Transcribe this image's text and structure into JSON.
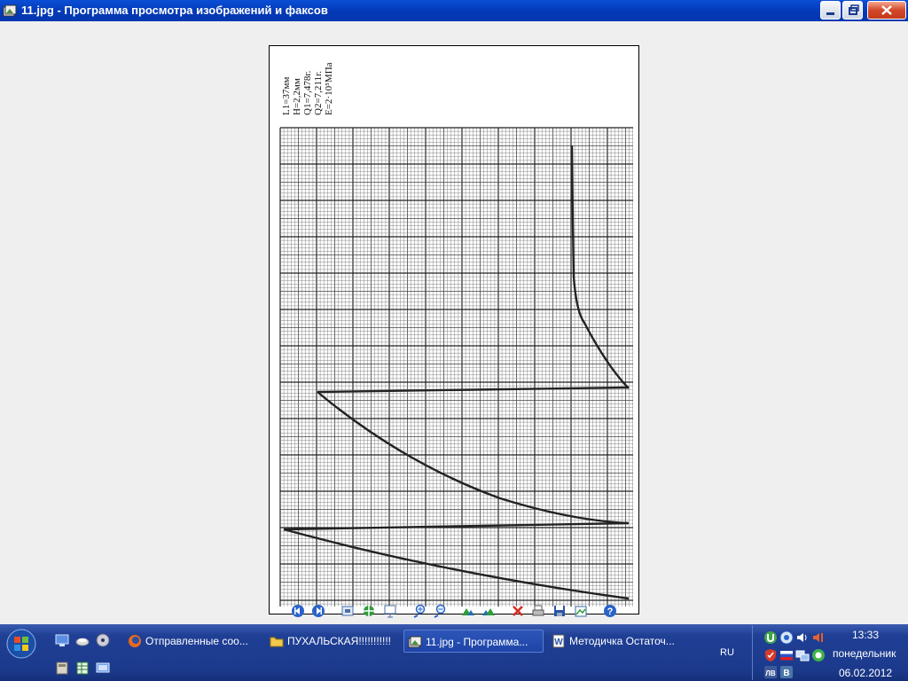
{
  "window": {
    "title": "11.jpg - Программа просмотра изображений и факсов",
    "controls": [
      "minimize",
      "restore",
      "close"
    ]
  },
  "image": {
    "annotation_lines": [
      "L1=37мм",
      "H=2,2мм",
      "Q1=7,478г.",
      "Q2=7,211г.",
      "E=2·10⁵МПа"
    ]
  },
  "toolbar": {
    "buttons": [
      {
        "icon": "previous-image-icon"
      },
      {
        "icon": "next-image-icon"
      },
      {
        "icon": "best-fit-icon"
      },
      {
        "icon": "actual-size-icon"
      },
      {
        "icon": "slideshow-icon"
      },
      {
        "icon": "zoom-in-icon"
      },
      {
        "icon": "zoom-out-icon"
      },
      {
        "icon": "rotate-clockwise-icon"
      },
      {
        "icon": "rotate-counterclockwise-icon"
      },
      {
        "icon": "delete-icon"
      },
      {
        "icon": "print-icon"
      },
      {
        "icon": "save-icon"
      },
      {
        "icon": "open-for-editing-icon"
      },
      {
        "icon": "help-icon"
      }
    ]
  },
  "taskbar": {
    "tasks": [
      {
        "label": "Отправленные соо...",
        "icon": "firefox-icon",
        "active": false
      },
      {
        "label": "ПУХАЛЬСКАЯ!!!!!!!!!!!",
        "icon": "folder-icon",
        "active": false
      },
      {
        "label": "11.jpg - Программа...",
        "icon": "image-viewer-icon",
        "active": true
      },
      {
        "label": "Методичка Остаточ...",
        "icon": "word-icon",
        "active": false
      }
    ],
    "language": "RU",
    "clock": {
      "time": "13:33",
      "day": "понедельник",
      "date": "06.02.2012"
    }
  }
}
